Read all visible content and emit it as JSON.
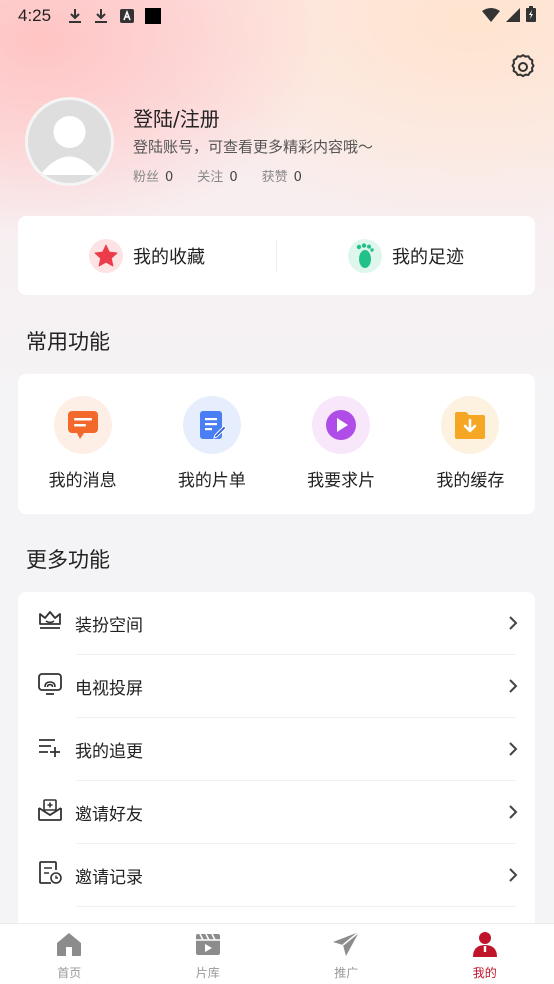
{
  "status_bar": {
    "time": "4:25"
  },
  "user": {
    "title": "登陆/注册",
    "subtitle": "登陆账号，可查看更多精彩内容哦～",
    "stats": [
      {
        "label": "粉丝",
        "value": "0"
      },
      {
        "label": "关注",
        "value": "0"
      },
      {
        "label": "获赞",
        "value": "0"
      }
    ]
  },
  "quick": {
    "favorites_label": "我的收藏",
    "footprints_label": "我的足迹"
  },
  "common": {
    "title": "常用功能",
    "items": [
      {
        "label": "我的消息",
        "icon": "message-icon"
      },
      {
        "label": "我的片单",
        "icon": "playlist-icon"
      },
      {
        "label": "我要求片",
        "icon": "play-icon"
      },
      {
        "label": "我的缓存",
        "icon": "download-folder-icon"
      }
    ]
  },
  "more": {
    "title": "更多功能",
    "items": [
      {
        "label": "装扮空间",
        "icon": "crown-icon"
      },
      {
        "label": "电视投屏",
        "icon": "cast-icon"
      },
      {
        "label": "我的追更",
        "icon": "list-add-icon"
      },
      {
        "label": "邀请好友",
        "icon": "invite-icon"
      },
      {
        "label": "邀请记录",
        "icon": "record-icon"
      }
    ]
  },
  "tabs": [
    {
      "label": "首页",
      "icon": "home-icon"
    },
    {
      "label": "片库",
      "icon": "film-icon"
    },
    {
      "label": "推广",
      "icon": "paper-plane-icon"
    },
    {
      "label": "我的",
      "icon": "person-icon",
      "active": true
    }
  ],
  "colors": {
    "accent": "#c0142b",
    "orange": "#f2692b",
    "blue": "#4a7ef5",
    "purple": "#b04ce8",
    "yellow": "#f5a623",
    "green": "#22c18a"
  }
}
